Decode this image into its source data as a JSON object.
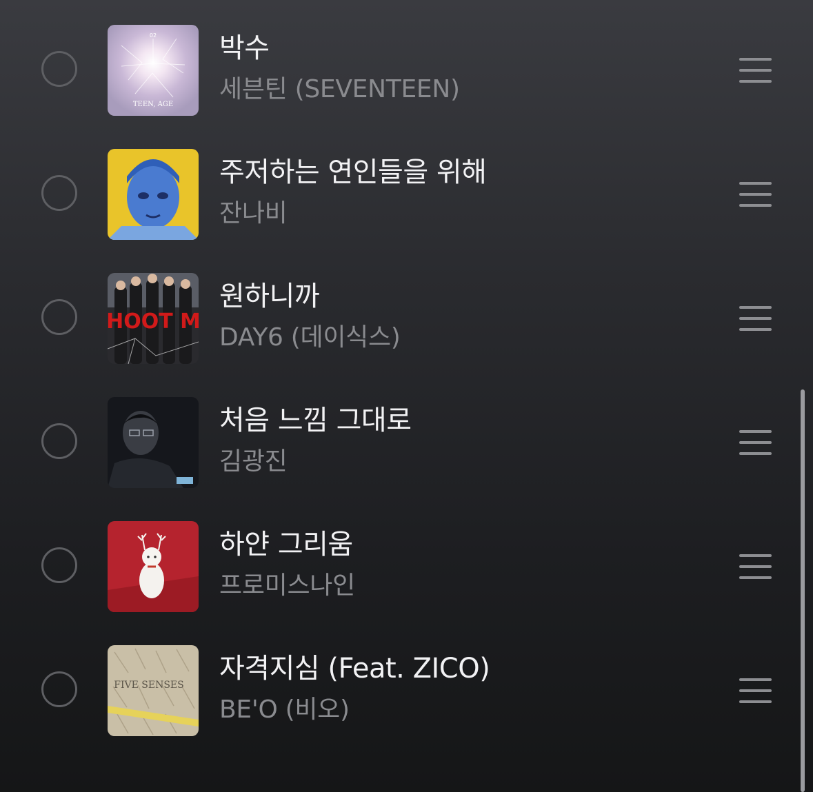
{
  "songs": [
    {
      "title": "박수",
      "artist": "세븐틴 (SEVENTEEN)",
      "album_text": "TEEN, AGE"
    },
    {
      "title": "주저하는 연인들을 위해",
      "artist": "잔나비"
    },
    {
      "title": "원하니까",
      "artist": "DAY6 (데이식스)",
      "album_text": "SHOOT ME"
    },
    {
      "title": "처음 느낌 그대로",
      "artist": "김광진"
    },
    {
      "title": "하얀 그리움",
      "artist": "프로미스나인"
    },
    {
      "title": "자격지심 (Feat. ZICO)",
      "artist": "BE'O (비오)",
      "album_text": "FIVE SENSES"
    }
  ],
  "icons": {
    "select": "circle-outline-icon",
    "reorder": "drag-handle-icon"
  },
  "colors": {
    "title": "#f2f2f4",
    "artist": "#8a8b8f",
    "background_top": "#3a3b40",
    "background_bottom": "#151617"
  }
}
